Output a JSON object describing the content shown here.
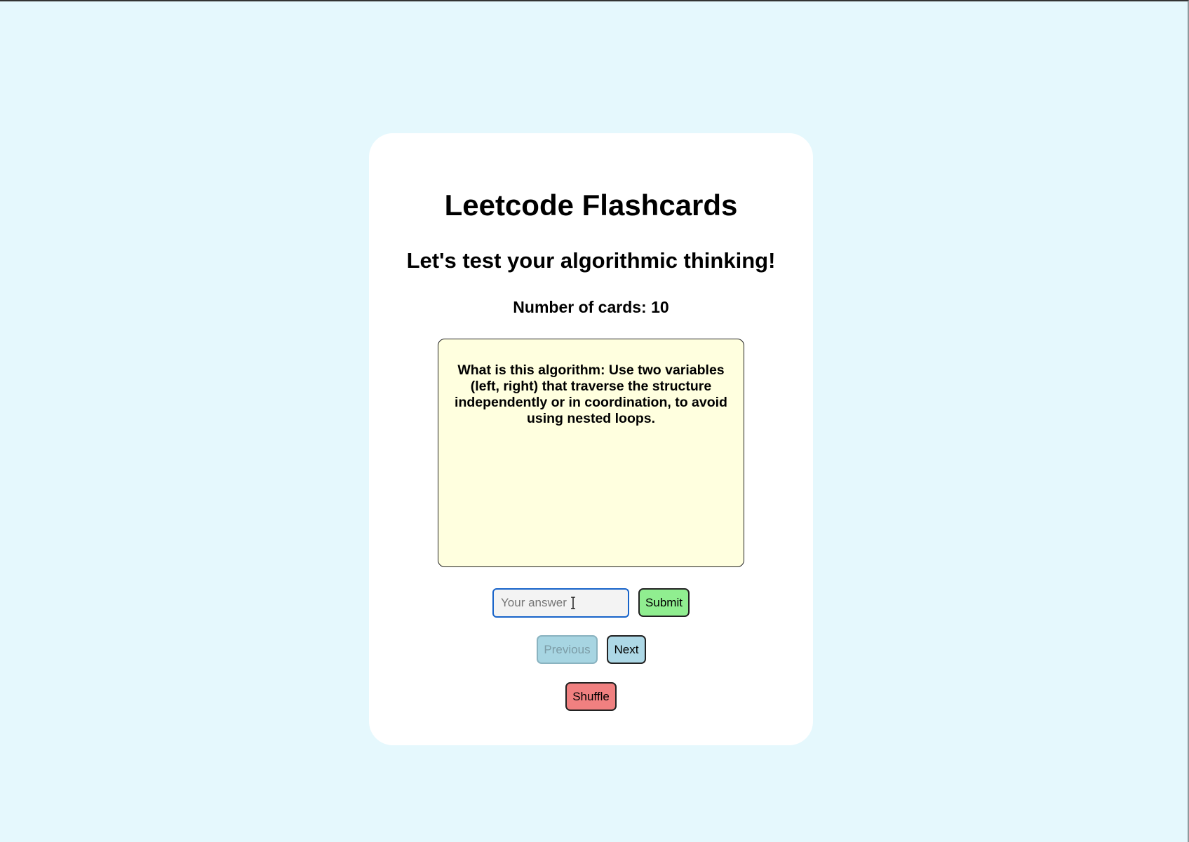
{
  "app": {
    "title": "Leetcode Flashcards",
    "subtitle": "Let's test your algorithmic thinking!",
    "card_count": "Number of cards: 10"
  },
  "flashcard": {
    "text": "What is this algorithm: Use two variables (left, right) that traverse the structure independently or in coordination, to avoid using nested loops."
  },
  "answer": {
    "value": "",
    "placeholder": "Your answer",
    "submit_label": "Submit"
  },
  "navigation": {
    "previous_label": "Previous",
    "previous_disabled": true,
    "next_label": "Next"
  },
  "actions": {
    "shuffle_label": "Shuffle"
  },
  "colors": {
    "page_background": "#e5f8fd",
    "card_background": "#ffffff",
    "flashcard_background": "#ffffdf",
    "submit_button": "#90ee90",
    "nav_button": "#add8e6",
    "shuffle_button": "#f08080",
    "input_focus_border": "#1763c9"
  },
  "icons": {
    "mouse_cursor": "text-cursor-icon"
  }
}
